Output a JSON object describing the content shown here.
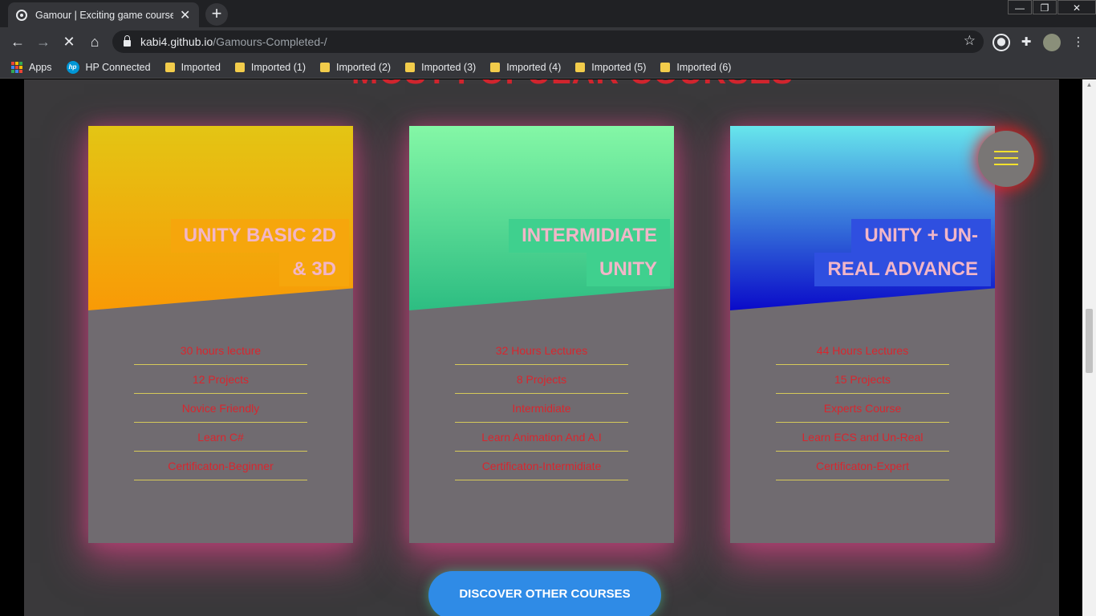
{
  "browser": {
    "tab_title": "Gamour | Exciting game courses f",
    "url_host": "kabi4.github.io",
    "url_path": "/Gamours-Completed-/",
    "bookmarks": [
      {
        "label": "Apps",
        "icon": "apps-grid-icon"
      },
      {
        "label": "HP Connected",
        "icon": "hp-logo-icon"
      },
      {
        "label": "Imported",
        "icon": "folder-icon"
      },
      {
        "label": "Imported (1)",
        "icon": "folder-icon"
      },
      {
        "label": "Imported (2)",
        "icon": "folder-icon"
      },
      {
        "label": "Imported (3)",
        "icon": "folder-icon"
      },
      {
        "label": "Imported (4)",
        "icon": "folder-icon"
      },
      {
        "label": "Imported (5)",
        "icon": "folder-icon"
      },
      {
        "label": "Imported (6)",
        "icon": "folder-icon"
      }
    ]
  },
  "page": {
    "heading": "MOST POPULAR COURSES",
    "cards": [
      {
        "title_line1": "UNITY BASIC 2D",
        "title_line2": "& 3D",
        "gradient_top": "#e3c514",
        "gradient_bottom": "#f99a06",
        "label_bg": "#f6a60c",
        "features": [
          "30 hours lecture",
          "12 Projects",
          "Novice Friendly",
          "Learn C#",
          "Certificaton-Beginner"
        ]
      },
      {
        "title_line1": "INTERMIDIATE",
        "title_line2": "UNITY",
        "gradient_top": "#84f7a6",
        "gradient_bottom": "#2dbd82",
        "label_bg": "#3fd08e",
        "features": [
          "32 Hours Lectures",
          "8 Projects",
          "Intermidiate",
          "Learn Animation And A.I",
          "Certificaton-Intermidiate"
        ]
      },
      {
        "title_line1": "UNITY + UN-",
        "title_line2": "REAL ADVANCE",
        "gradient_top": "#67e6ec",
        "gradient_bottom": "#0a0ac9",
        "label_bg": "#2f4fe0",
        "features": [
          "44 Hours Lectures",
          "15 Projects",
          "Experts Course",
          "Learn ECS and Un-Real",
          "Certificaton-Expert"
        ]
      }
    ],
    "discover_button": "DISCOVER OTHER COURSES"
  }
}
